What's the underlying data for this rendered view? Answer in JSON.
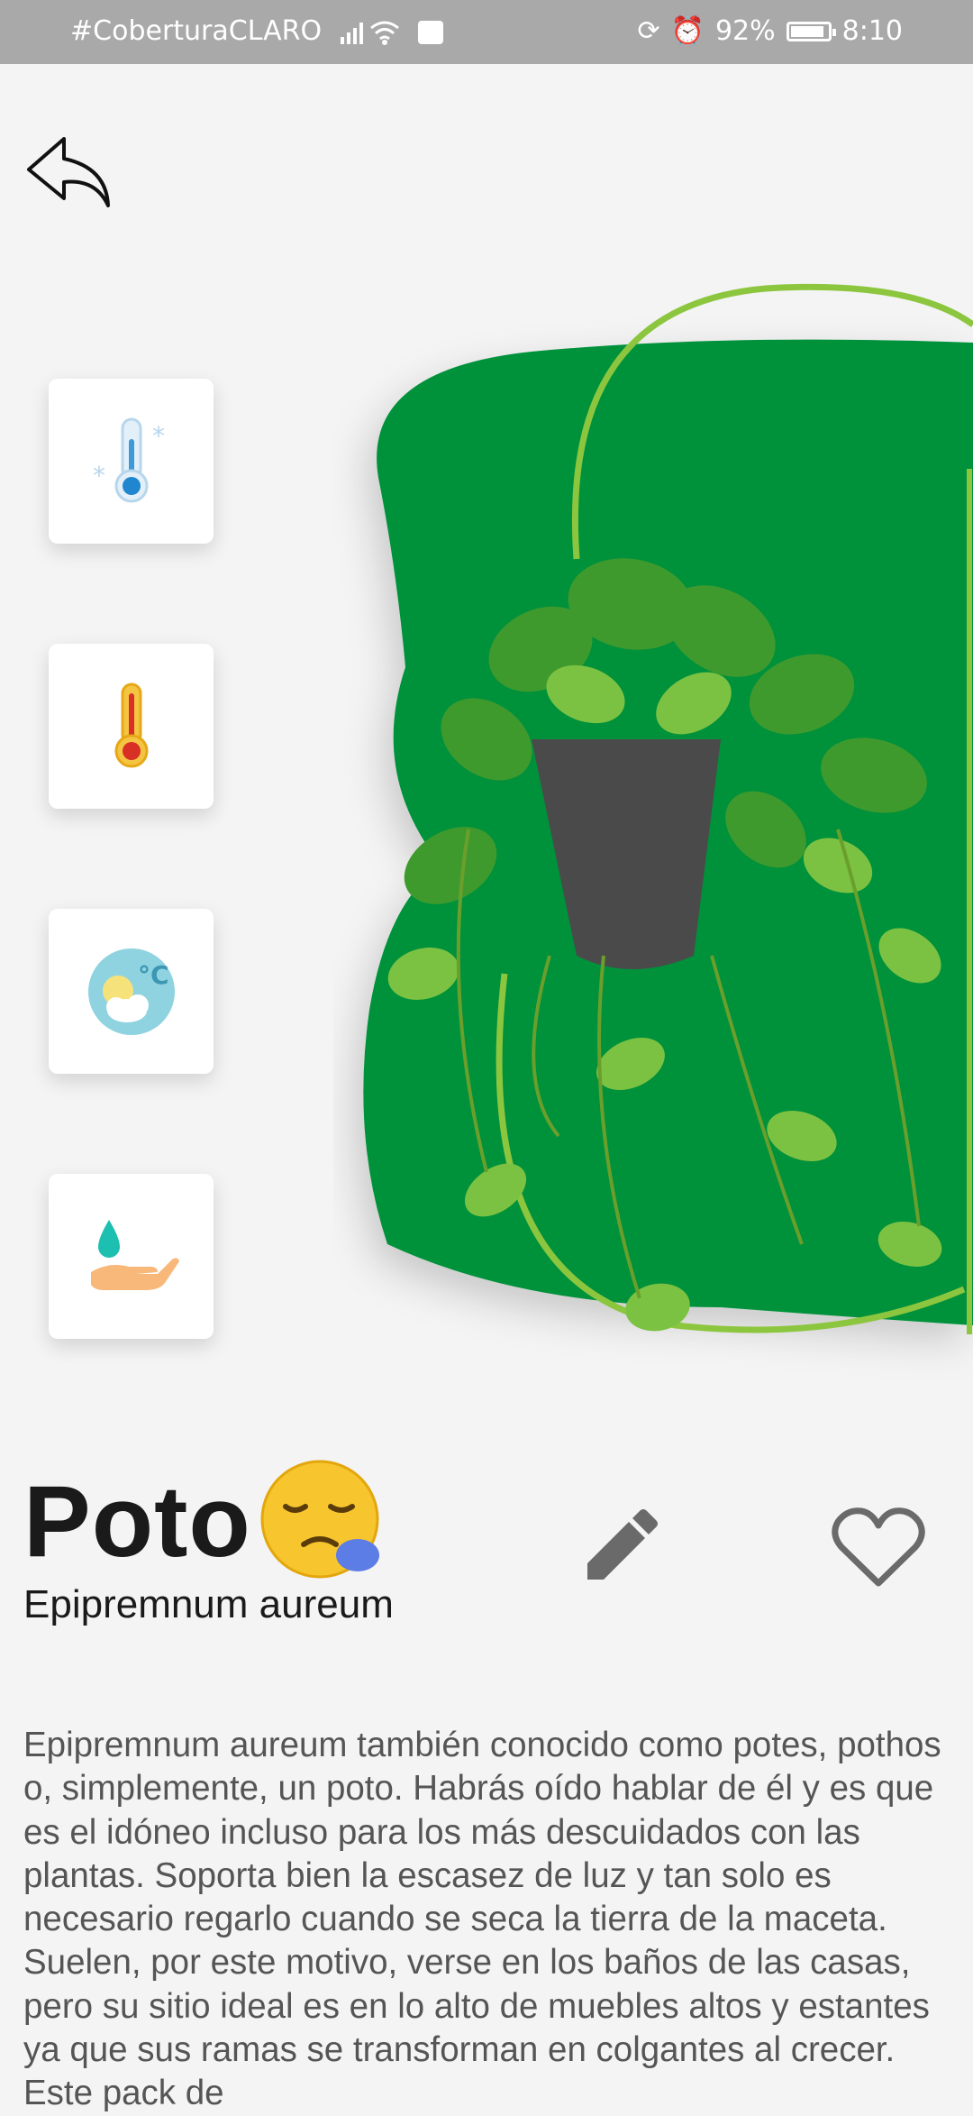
{
  "status_bar": {
    "carrier": "#CoberturaCLARO",
    "battery": "92%",
    "time": "8:10"
  },
  "navigation": {
    "back_icon": "back-arrow-icon"
  },
  "care_icons": [
    {
      "icon": "cold-thermometer-icon"
    },
    {
      "icon": "hot-thermometer-icon"
    },
    {
      "icon": "weather-celsius-icon"
    },
    {
      "icon": "watering-hand-icon"
    }
  ],
  "plant": {
    "name": "Poto",
    "mood_emoji": "sleepy-face-icon",
    "scientific_name": "Epipremnum aureum",
    "description": "Epipremnum aureum también conocido como potes, pothos o, simplemente, un poto. Habrás oído hablar de él y es que es el idóneo incluso para los más descuidados con las plantas. Soporta bien la escasez de luz y tan solo es necesario regarlo cuando se seca la tierra de la maceta. Suelen, por este motivo, verse en los baños de las casas, pero su sitio ideal es en lo alto de muebles altos y estantes ya que sus ramas se transforman en colgantes al crecer. Este pack de"
  },
  "actions": {
    "edit_icon": "pencil-icon",
    "favorite_icon": "heart-outline-icon"
  },
  "colors": {
    "hero_green": "#04913a",
    "accent_lime": "#8cc63f",
    "background": "#f4f4f4",
    "icon_gray": "#6a6a6a"
  }
}
